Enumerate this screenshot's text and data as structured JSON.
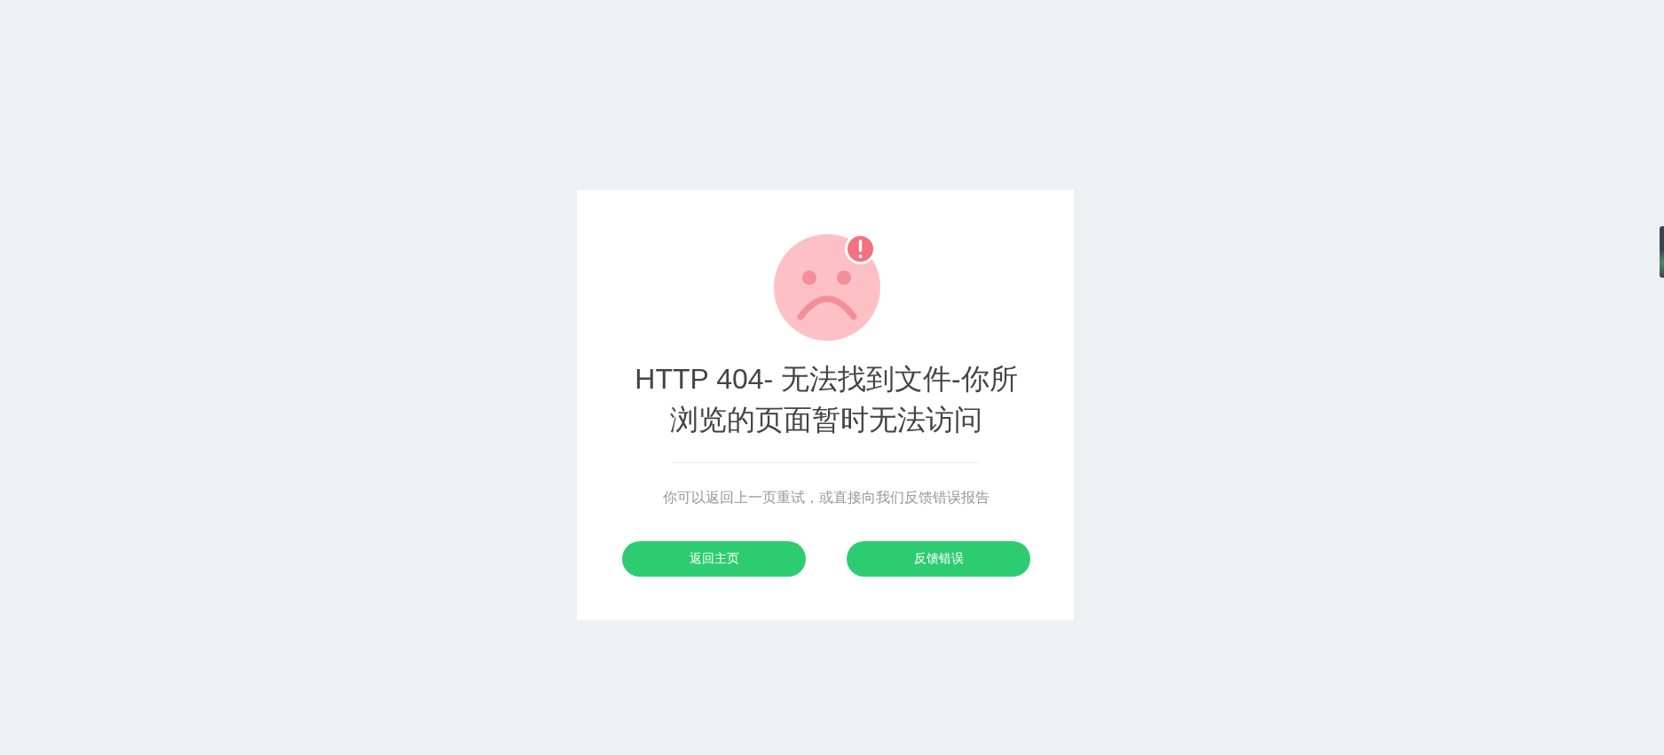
{
  "error_card": {
    "title": "HTTP 404- 无法找到文件-你所浏览的页面暂时无法访问",
    "message": "你可以返回上一页重试，或直接向我们反馈错误报告",
    "buttons": [
      {
        "label": "返回主页"
      },
      {
        "label": "反馈错误"
      }
    ]
  }
}
